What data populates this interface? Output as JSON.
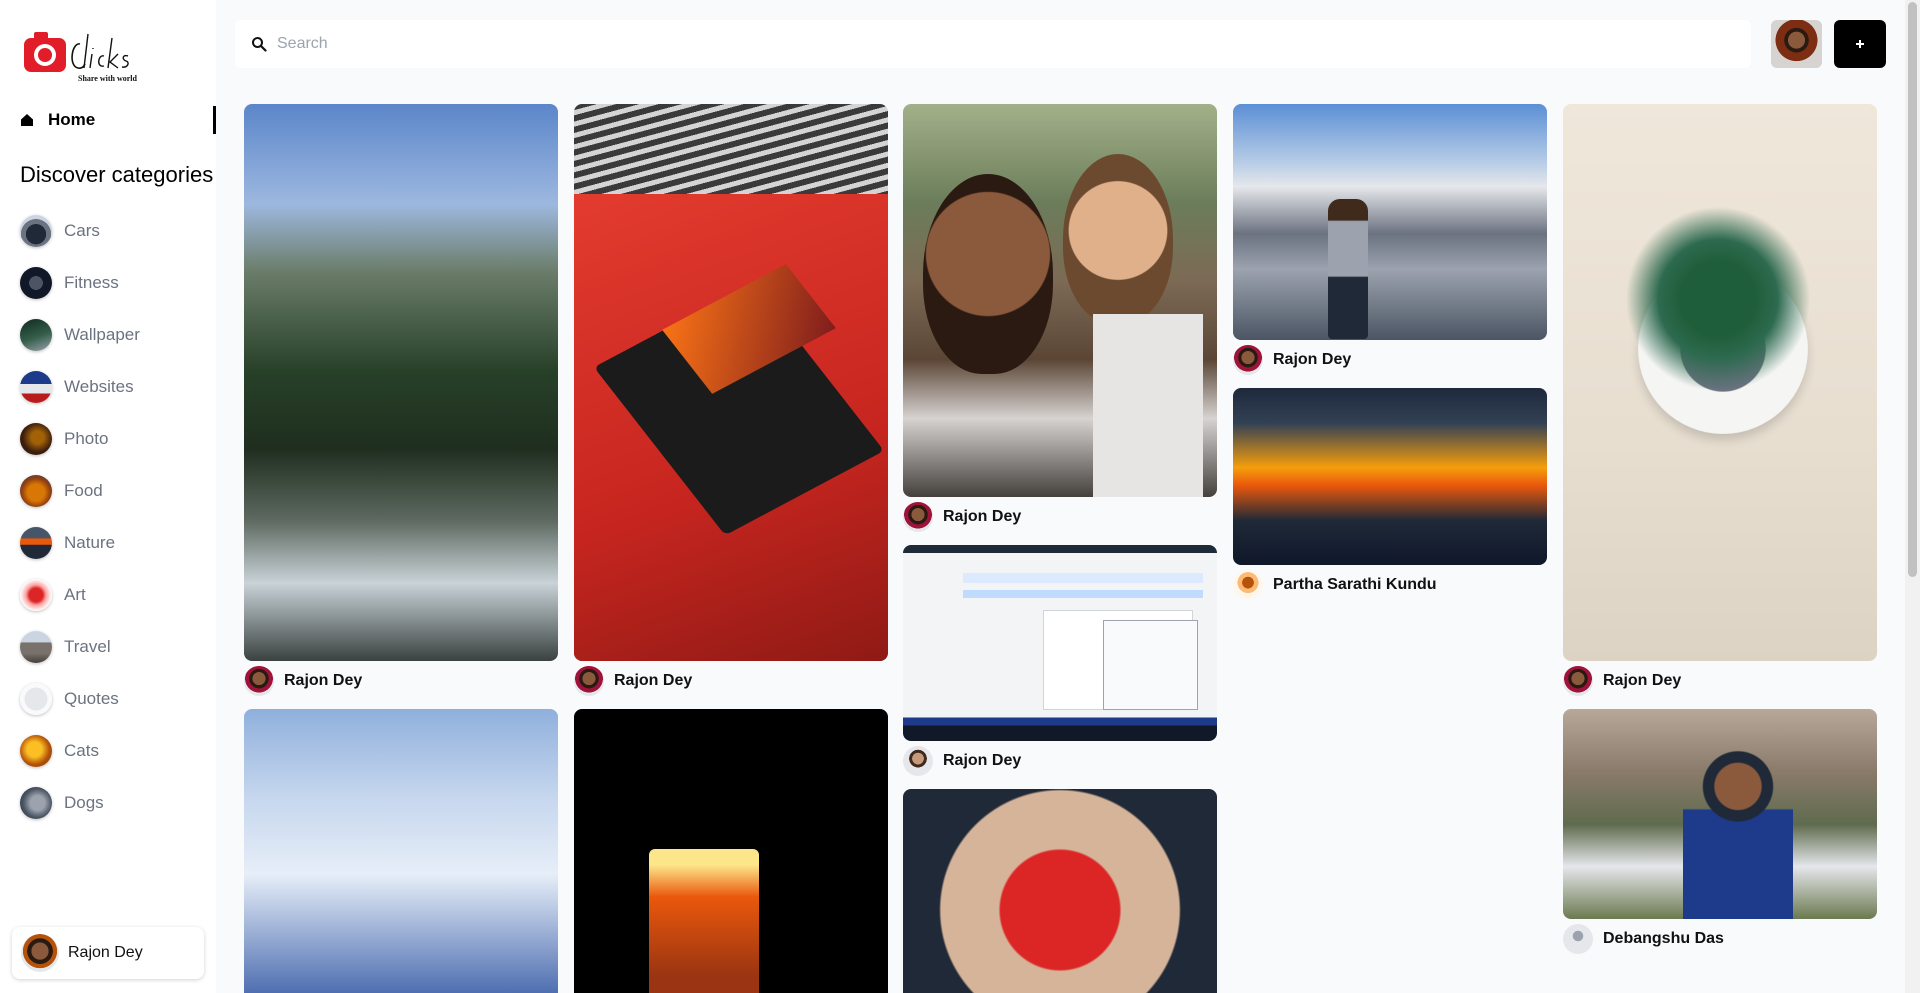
{
  "brand": {
    "name": "Clicks",
    "tagline": "Share with world",
    "accent": "#e11d2a"
  },
  "nav": {
    "home_label": "Home"
  },
  "discover_title": "Discover categories",
  "categories": [
    {
      "label": "Cars"
    },
    {
      "label": "Fitness"
    },
    {
      "label": "Wallpaper"
    },
    {
      "label": "Websites"
    },
    {
      "label": "Photo"
    },
    {
      "label": "Food"
    },
    {
      "label": "Nature"
    },
    {
      "label": "Art"
    },
    {
      "label": "Travel"
    },
    {
      "label": "Quotes"
    },
    {
      "label": "Cats"
    },
    {
      "label": "Dogs"
    }
  ],
  "search": {
    "placeholder": "Search",
    "value": ""
  },
  "header": {
    "add_icon": "plus-icon"
  },
  "current_user": {
    "name": "Rajon Dey"
  },
  "pins": [
    {
      "author": "Rajon Dey",
      "image": "mountain-river"
    },
    {
      "author": "Rajon Dey",
      "image": "laptop-on-red-cloth"
    },
    {
      "author": "Rajon Dey",
      "image": "selfie-two-hikers"
    },
    {
      "author": "Rajon Dey",
      "image": "hiker-snow-mountains"
    },
    {
      "author": "Rajon Dey",
      "image": "succulent-pot"
    },
    {
      "author": "Partha Sarathi Kundu",
      "image": "sunset-clouds"
    },
    {
      "author": "Rajon Dey",
      "image": "calendar-app-screen"
    },
    {
      "author": "Debangshu Das",
      "image": "man-in-hills"
    },
    {
      "author": "",
      "image": "airplane-wing-sky"
    },
    {
      "author": "",
      "image": "cocktail-glass"
    },
    {
      "author": "",
      "image": "painted-hands-heart"
    }
  ]
}
